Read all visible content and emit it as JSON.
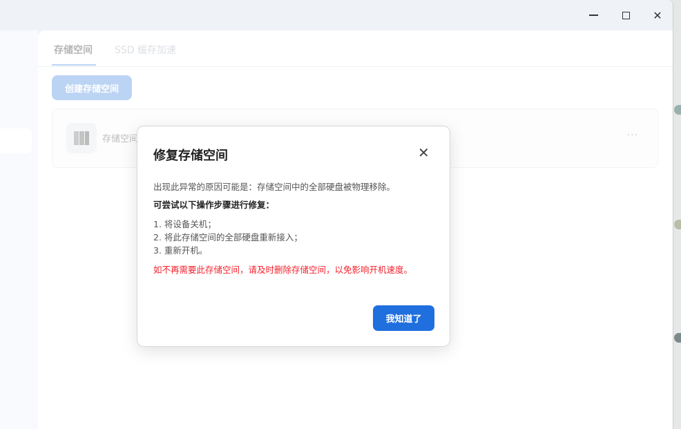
{
  "window": {
    "minimize": "—",
    "maximize": "☐",
    "close": "✕"
  },
  "tabs": [
    {
      "label": "存储空间"
    },
    {
      "label": "SSD 缓存加速"
    }
  ],
  "create_button": "创建存储空间",
  "card": {
    "name": "存储空间",
    "more": "···"
  },
  "dialog": {
    "title": "修复存储空间",
    "close": "✕",
    "cause": "出现此异常的原因可能是：存储空间中的全部硬盘被物理移除。",
    "steps_heading": "可尝试以下操作步骤进行修复：",
    "steps": [
      "1. 将设备关机；",
      "2. 将此存储空间的全部硬盘重新接入；",
      "3. 重新开机。"
    ],
    "warning": "如不再需要此存储空间，请及时删除存储空间，以免影响开机速度。",
    "ok_button": "我知道了"
  },
  "colors": {
    "accent": "#1f6fde",
    "warning": "#f5222d"
  }
}
